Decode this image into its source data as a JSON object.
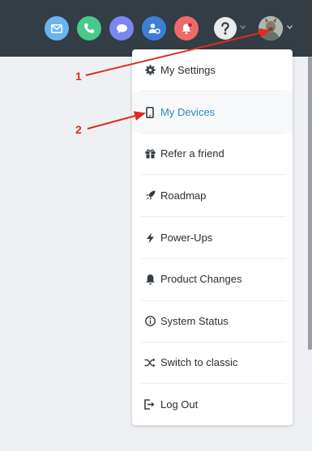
{
  "topbar": {
    "icons": [
      {
        "name": "mail-icon",
        "color": "#6ab4f2"
      },
      {
        "name": "phone-icon",
        "color": "#49c98a"
      },
      {
        "name": "chat-icon",
        "color": "#7a86f2"
      },
      {
        "name": "user-settings-icon",
        "color": "#3b7fd6"
      },
      {
        "name": "notification-icon",
        "color": "#ef6a6a"
      },
      {
        "name": "help-icon",
        "color": "#e9ebed"
      }
    ]
  },
  "menu": {
    "items": [
      {
        "label": "My Settings",
        "icon": "gear-icon"
      },
      {
        "label": "My Devices",
        "icon": "mobile-icon"
      },
      {
        "label": "Refer a friend",
        "icon": "gift-icon"
      },
      {
        "label": "Roadmap",
        "icon": "rocket-icon"
      },
      {
        "label": "Power-Ups",
        "icon": "bolt-icon"
      },
      {
        "label": "Product Changes",
        "icon": "bell-icon"
      },
      {
        "label": "System Status",
        "icon": "info-icon"
      },
      {
        "label": "Switch to classic",
        "icon": "shuffle-icon"
      },
      {
        "label": "Log Out",
        "icon": "logout-icon"
      }
    ],
    "active_item": "My Devices"
  },
  "annotations": {
    "step1": "1",
    "step2": "2",
    "arrow_color": "#e02a1d"
  }
}
